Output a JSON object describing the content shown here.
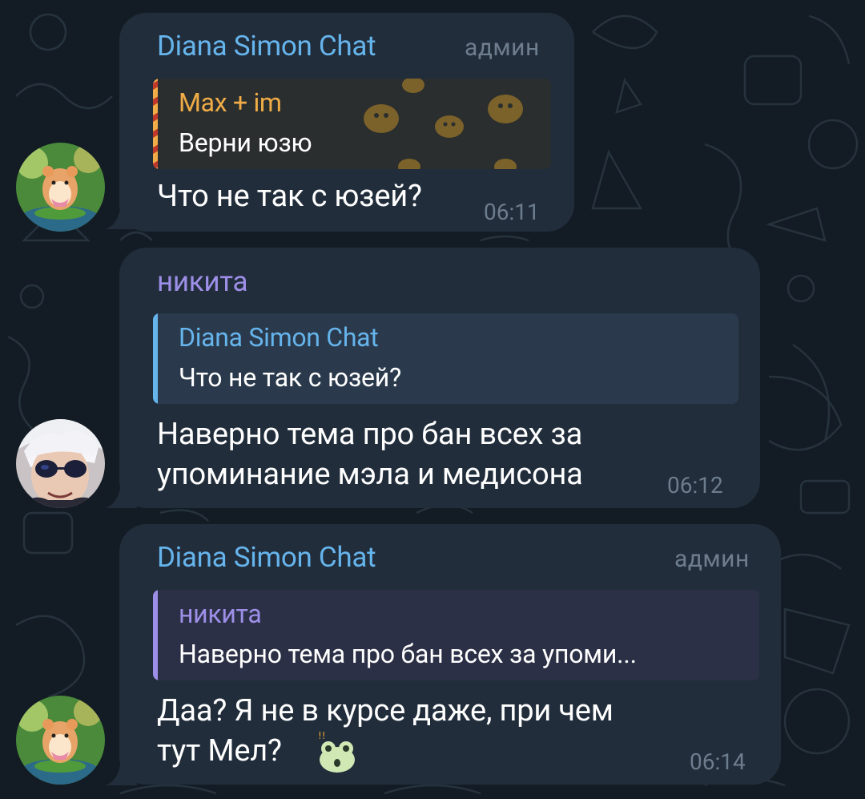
{
  "colors": {
    "background": "#131c24",
    "bubble": "#212d3b",
    "admin_name": "#66b4ec",
    "user_name": "#9d8fe8",
    "reply_orange_name": "#f0ac46",
    "muted": "#6e7d8e"
  },
  "messages": [
    {
      "sender": "Diana Simon Chat",
      "badge": "админ",
      "reply_name": "Max + im",
      "reply_text": "Верни юзю",
      "text": "Что не так с юзей?",
      "time": "06:11",
      "avatar": "hamster-avatar"
    },
    {
      "sender": "никита",
      "reply_name": "Diana Simon Chat",
      "reply_text": "Что не так с юзей?",
      "text_line1": "Наверно тема про бан всех за",
      "text_line2": "упоминание мэла и медисона",
      "time": "06:12",
      "avatar": "anime-boy-sunglasses-avatar"
    },
    {
      "sender": "Diana Simon Chat",
      "badge": "админ",
      "reply_name": "никита",
      "reply_text": "Наверно тема про бан всех за упоми...",
      "text_line1": "Даа? Я не в курсе даже, при чем",
      "text_line2": "тут Мел?",
      "emoji": "frog-shocked-emoji",
      "time": "06:14",
      "avatar": "hamster-avatar"
    }
  ]
}
